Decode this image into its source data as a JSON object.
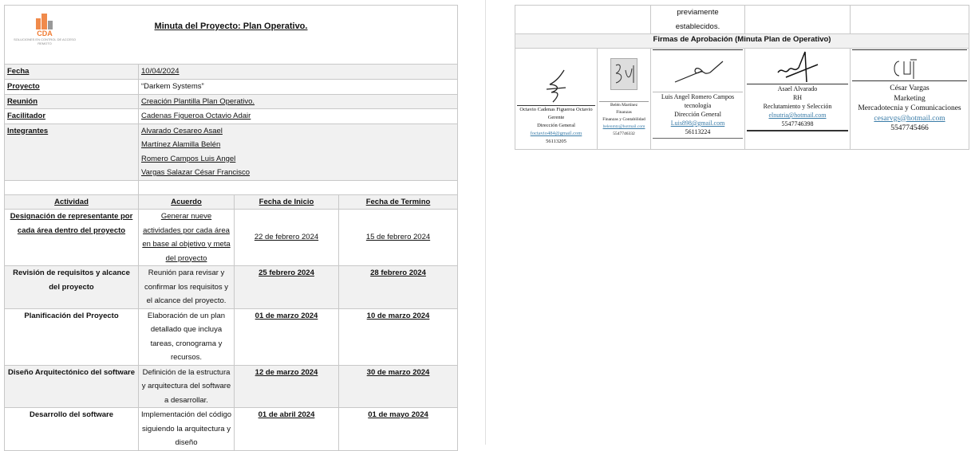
{
  "header": {
    "logo_name": "CDA",
    "logo_tagline": "SOLUCIONES EN CONTROL DE ACCESO REMOTO",
    "title": "Minuta del Proyecto: Plan Operativo."
  },
  "info": [
    {
      "label": "Fecha",
      "value": " 10/04/2024"
    },
    {
      "label": "Proyecto",
      "value": "“Darkem Systems”"
    },
    {
      "label": "Reunión",
      "value": "Creación Plantilla Plan Operativo."
    },
    {
      "label": "Facilitador",
      "value": "Cadenas Figueroa Octavio Adair"
    }
  ],
  "integrantes": {
    "label": "Integrantes",
    "members": [
      "Alvarado Cesareo Asael",
      "Martínez Alamilla Belén",
      "Romero Campos Luis Angel",
      "Vargas Salazar César Francisco"
    ]
  },
  "activities": {
    "headers": [
      "Actividad",
      "Acuerdo",
      "Fecha de Inicio",
      "Fecha de Termino"
    ],
    "rows": [
      {
        "actividad": "Designación de representante por cada área dentro del proyecto",
        "acuerdo": "Generar nueve actividades por cada área en base al objetivo y meta del proyecto",
        "inicio": "22 de febrero 2024",
        "termino": "15 de febrero 2024"
      },
      {
        "actividad": "Revisión de requisitos y alcance del proyecto",
        "acuerdo": "Reunión para revisar y confirmar los requisitos y el alcance del proyecto.",
        "inicio": "25 febrero 2024",
        "termino": "28 febrero 2024"
      },
      {
        "actividad": "Planificación del Proyecto",
        "acuerdo": "Elaboración de un plan detallado que incluya tareas, cronograma y recursos.",
        "inicio": "01 de marzo 2024",
        "termino": "10 de marzo 2024"
      },
      {
        "actividad": "Diseño Arquitectónico del software",
        "acuerdo": "Definición de la estructura y arquitectura del software a desarrollar.",
        "inicio": "12 de marzo 2024",
        "termino": "30 de marzo 2024"
      },
      {
        "actividad": "Desarrollo del software",
        "acuerdo": "Implementación del código siguiendo la arquitectura y diseño",
        "inicio": "01 de abril 2024",
        "termino": "01 de mayo 2024"
      }
    ]
  },
  "continuation": {
    "acuerdo_tail": [
      "previamente",
      "establecidos."
    ]
  },
  "firmas": {
    "title": "Firmas de Aprobación (Minuta Plan de Operativo)",
    "signers": [
      {
        "name": "Octavio Cadenas Figueroa Octavio",
        "role": "Gerente",
        "area": "Dirección General",
        "email": "foctavio484@gmail.com",
        "phone": "56113205"
      },
      {
        "name": "Belén Martínez",
        "role": "Finanzas",
        "area": "Finanzas y Contabilidad",
        "email": "belenmtz@hotmail.com",
        "phone": "5547746332"
      },
      {
        "name": "Luis Angel Romero Campos",
        "role": "tecnología",
        "area": "Dirección General",
        "email": "Luis898@gmail.com",
        "phone": "56113224"
      },
      {
        "name": "Asael Alvarado",
        "role": "RH",
        "area": "Reclutamiento y Selección",
        "email": "elnutria@hotmail.com",
        "phone": "5547746398"
      },
      {
        "name": "César Vargas",
        "role": "Marketing",
        "area": "Mercadotecnia y Comunicaciones",
        "email": "cesarvgs@hotmail.com",
        "phone": "5547745466"
      }
    ]
  }
}
